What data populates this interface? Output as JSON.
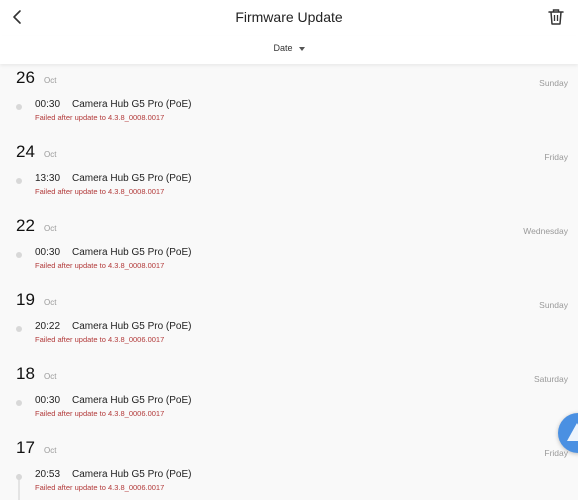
{
  "header": {
    "title": "Firmware Update"
  },
  "filter": {
    "sort_label": "Date"
  },
  "days": [
    {
      "day": "26",
      "month": "Oct",
      "weekday": "Sunday",
      "entry": {
        "time": "00:30",
        "device": "Camera Hub G5 Pro (PoE)",
        "status": "Failed after update to 4.3.8_0008.0017"
      }
    },
    {
      "day": "24",
      "month": "Oct",
      "weekday": "Friday",
      "entry": {
        "time": "13:30",
        "device": "Camera Hub G5 Pro (PoE)",
        "status": "Failed after update to 4.3.8_0008.0017"
      }
    },
    {
      "day": "22",
      "month": "Oct",
      "weekday": "Wednesday",
      "entry": {
        "time": "00:30",
        "device": "Camera Hub G5 Pro (PoE)",
        "status": "Failed after update to 4.3.8_0008.0017"
      }
    },
    {
      "day": "19",
      "month": "Oct",
      "weekday": "Sunday",
      "entry": {
        "time": "20:22",
        "device": "Camera Hub G5 Pro (PoE)",
        "status": "Failed after update to 4.3.8_0006.0017"
      }
    },
    {
      "day": "18",
      "month": "Oct",
      "weekday": "Saturday",
      "entry": {
        "time": "00:30",
        "device": "Camera Hub G5 Pro (PoE)",
        "status": "Failed after update to 4.3.8_0006.0017"
      }
    },
    {
      "day": "17",
      "month": "Oct",
      "weekday": "Friday",
      "entry": {
        "time": "20:53",
        "device": "Camera Hub G5 Pro (PoE)",
        "status": "Failed after update to 4.3.8_0006.0017"
      }
    }
  ],
  "icons": {
    "back": "chevron-left-icon",
    "delete": "trash-icon",
    "sort_caret": "caret-down-icon",
    "floating": "assistant-icon"
  },
  "colors": {
    "status_failed": "#b23a3a",
    "accent": "#4a90e2"
  }
}
